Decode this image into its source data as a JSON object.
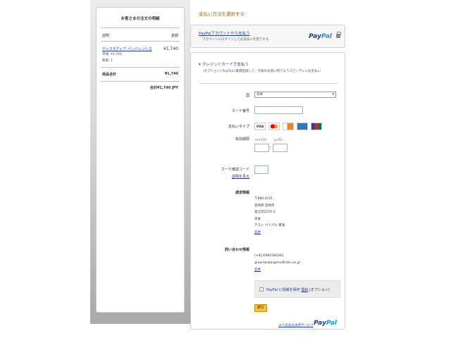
{
  "summary": {
    "title": "お客さまの注文の明細",
    "col_desc": "説明",
    "col_amount": "金額",
    "item": {
      "name": "ディスネディア ペンパレンシス",
      "price": "¥1,740",
      "unit_price": "単価: ¥1,740",
      "quantity": "数量: 1"
    },
    "subtotal_label": "商品合計",
    "subtotal_value": "¥1,740",
    "grand_total": "合計¥1,740 JPY"
  },
  "main": {
    "heading": "支払い方法を選択する",
    "paypal": {
      "link": "PayPalアカウントから支払う",
      "sub": "アカウントにログインしてお支払いを完了する",
      "logo_a": "Pay",
      "logo_b": "Pal"
    },
    "card": {
      "title": "クレジットカードで支払う",
      "subtitle": "(オプション) PayPalに無償登録して、今後のお買い物でよりスピーディにお支払い",
      "country_label": "国",
      "country_value": "日本",
      "card_number_label": "カード番号",
      "pay_type_label": "支払いタイプ",
      "brands": [
        "VISA",
        "",
        "",
        "",
        ""
      ],
      "expiry_label": "有効期限",
      "expiry_mm": "mm(月)",
      "expiry_yy": "yy(年)",
      "expiry_sep": "/",
      "cvv_label": "カード確認コード",
      "cvv_help": "説明を見る",
      "billing_label": "請求情報",
      "billing_lines": [
        "〒880-0121",
        "宮崎県 宮崎市",
        "島之内2270-3",
        "日本",
        "テスト ペイパル 東海"
      ],
      "billing_change": "変更",
      "contact_label": "問い合わせ情報",
      "phone": "(+81)0985383381",
      "email": "grow-toukai@mx36.tiki.ne.jp",
      "contact_change": "変更",
      "save_text": "PayPal に情報を保存",
      "save_link": "理由",
      "save_optional": "(オプション)",
      "continue_label": "続行",
      "secure_text": "より安全な決済サービス",
      "secure_logo_a": "Pay",
      "secure_logo_b": "Pal"
    }
  }
}
